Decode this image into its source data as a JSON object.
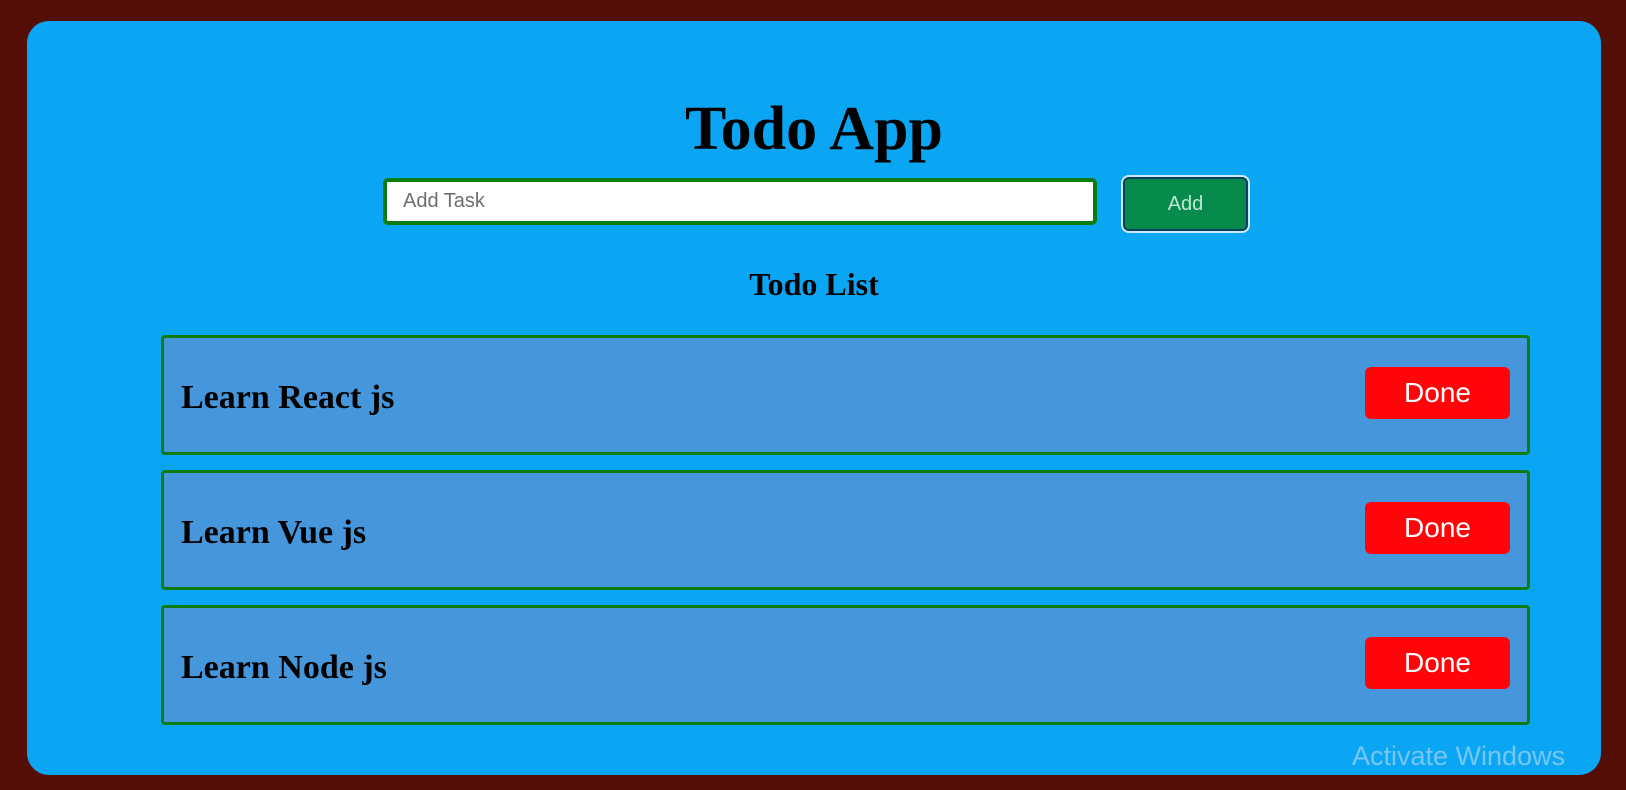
{
  "app": {
    "title": "Todo App",
    "input": {
      "placeholder": "Add Task",
      "value": ""
    },
    "add_button_label": "Add",
    "list_title": "Todo List",
    "todos": [
      {
        "text": "Learn React js",
        "done_label": "Done"
      },
      {
        "text": "Learn Vue js",
        "done_label": "Done"
      },
      {
        "text": "Learn Node js",
        "done_label": "Done"
      }
    ]
  },
  "os_overlay": {
    "watermark": "Activate Windows"
  },
  "colors": {
    "page_background": "#530f06",
    "app_background": "#0aa6f4",
    "item_background": "#4596db",
    "border_green": "#0a7d12",
    "add_button": "#078b4c",
    "done_button": "#ff0509"
  }
}
